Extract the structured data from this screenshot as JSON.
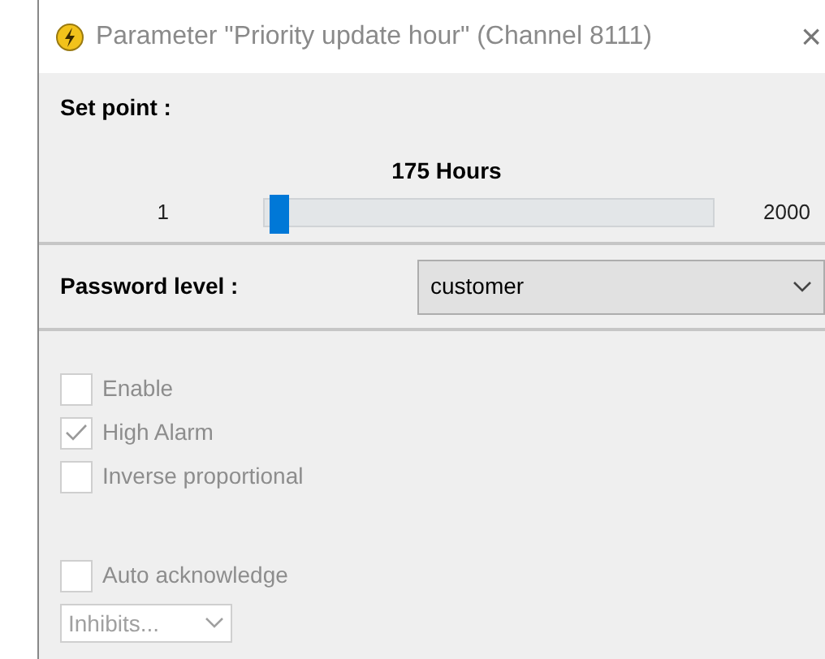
{
  "window": {
    "title": "Parameter \"Priority update hour\" (Channel 8111)",
    "close": "×"
  },
  "set_point": {
    "label": "Set point :",
    "reading": "175 Hours",
    "min": "1",
    "max": "2000",
    "level": 0.01
  },
  "password_level": {
    "label": "Password level :",
    "value": "customer"
  },
  "options": [
    {
      "label": "Enable",
      "checked": false,
      "disabled": true
    },
    {
      "label": "High Alarm",
      "checked": true,
      "disabled": true
    },
    {
      "label": "Inverse proportional",
      "checked": false,
      "disabled": true
    },
    {
      "label": "Auto acknowledge",
      "checked": false,
      "disabled": true,
      "gap": true
    }
  ],
  "inhibits": {
    "value": "Inhibits...",
    "disabled": true
  }
}
